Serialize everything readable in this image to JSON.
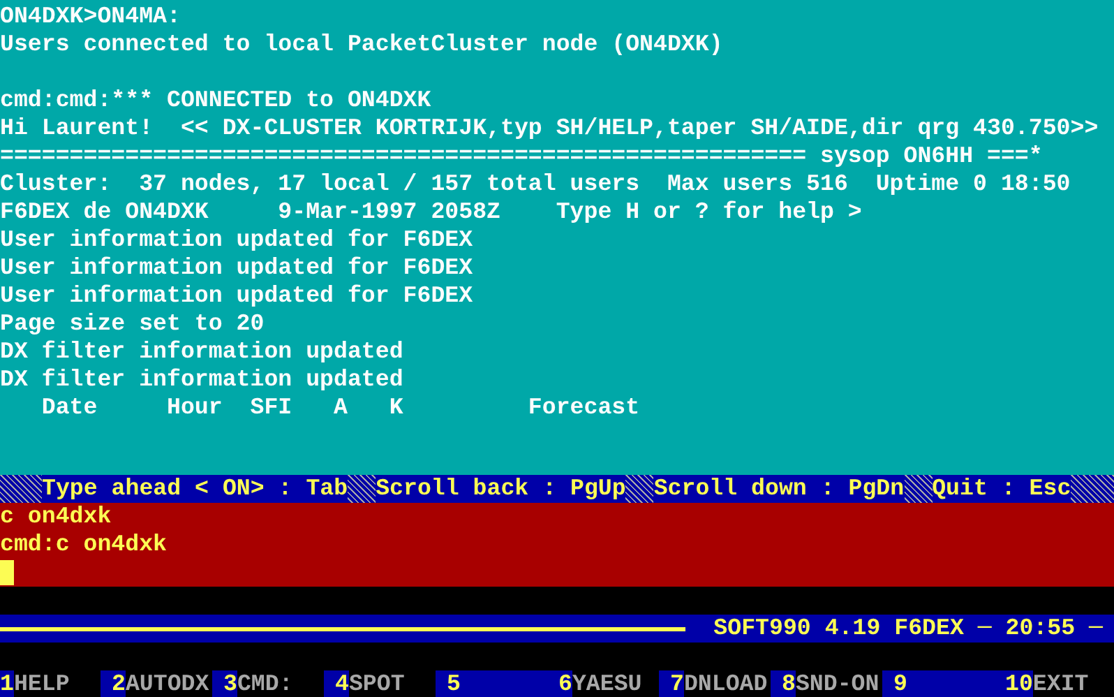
{
  "terminal": {
    "blocks": [
      [
        "ON4DXK>ON4MA:",
        "Users connected to local PacketCluster node (ON4DXK)"
      ],
      [
        "cmd:cmd:*** CONNECTED to ON4DXK",
        "Hi Laurent!  << DX-CLUSTER KORTRIJK,typ SH/HELP,taper SH/AIDE,dir qrg 430.750>>",
        "========================================================== sysop ON6HH ===*",
        "Cluster:  37 nodes, 17 local / 157 total users  Max users 516  Uptime 0 18:50",
        "F6DEX de ON4DXK     9-Mar-1997 2058Z    Type H or ? for help >",
        "User information updated for F6DEX",
        "User information updated for F6DEX",
        "User information updated for F6DEX",
        "Page size set to 20",
        "DX filter information updated",
        "DX filter information updated",
        "   Date     Hour  SFI   A   K         Forecast"
      ]
    ]
  },
  "hint_bar": {
    "hints": [
      "Type ahead < ON> : Tab",
      "Scroll back : PgUp",
      "Scroll down : PgDn",
      "Quit : Esc"
    ]
  },
  "input_pane": {
    "lines": [
      "c on4dxk",
      "cmd:c on4dxk"
    ]
  },
  "title_bar": {
    "title": "SOFT990 4.19 F6DEX ─ 20:55 ─"
  },
  "function_keys": [
    {
      "number": "1",
      "label": "HELP"
    },
    {
      "number": "2",
      "label": "AUTODX"
    },
    {
      "number": "3",
      "label": "CMD:"
    },
    {
      "number": "4",
      "label": "SPOT"
    },
    {
      "number": "5"
    },
    {
      "number": "6",
      "label": "YAESU"
    },
    {
      "number": "7",
      "label": "DNLOAD"
    },
    {
      "number": "8",
      "label": "SND-ON"
    },
    {
      "number": "9"
    },
    {
      "number": "10",
      "label": "EXIT"
    }
  ]
}
